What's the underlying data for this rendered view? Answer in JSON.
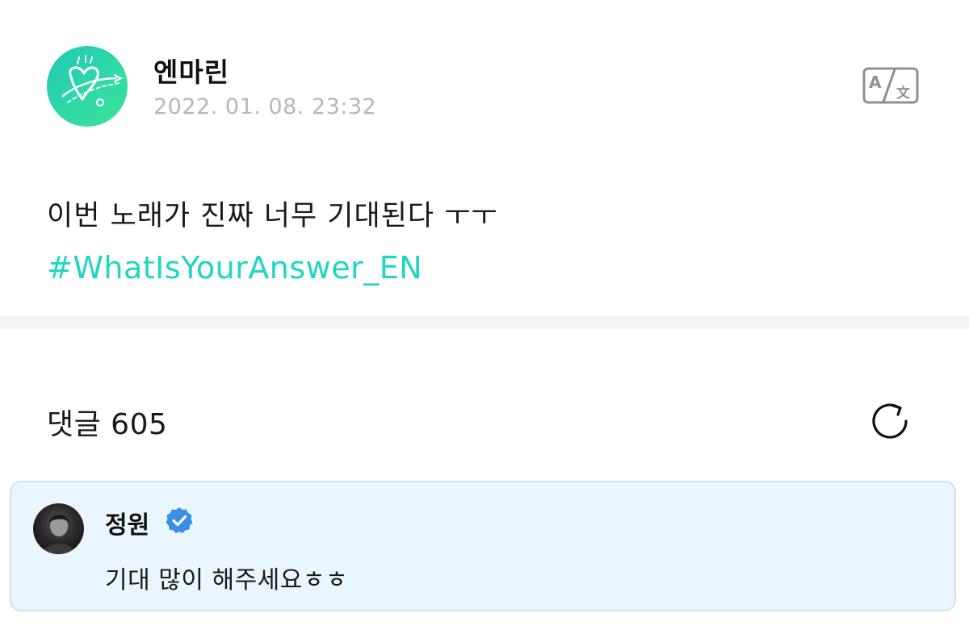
{
  "post": {
    "author": "엔마린",
    "date": "2022. 01. 08. 23:32",
    "text": "이번 노래가 진짜 너무 기대된다 ㅜㅜ",
    "hashtag": "#WhatIsYourAnswer_EN",
    "translate_icon": "translate-icon"
  },
  "comments": {
    "label": "댓글 605",
    "refresh_icon": "refresh-icon",
    "items": [
      {
        "author": "정원",
        "verified": true,
        "verified_icon": "verified-badge-icon",
        "text": "기대 많이 해주세요ㅎㅎ"
      }
    ]
  },
  "colors": {
    "hashtag": "#1fd6c1",
    "avatar_gradient_start": "#22c7b8",
    "avatar_gradient_end": "#3ee29a",
    "comment_card_bg": "#eaf6fd",
    "comment_card_border": "#cbe4ef",
    "verified_badge": "#3b8fe5",
    "date_text": "#b4b7bd",
    "divider": "#f4f5f9"
  }
}
